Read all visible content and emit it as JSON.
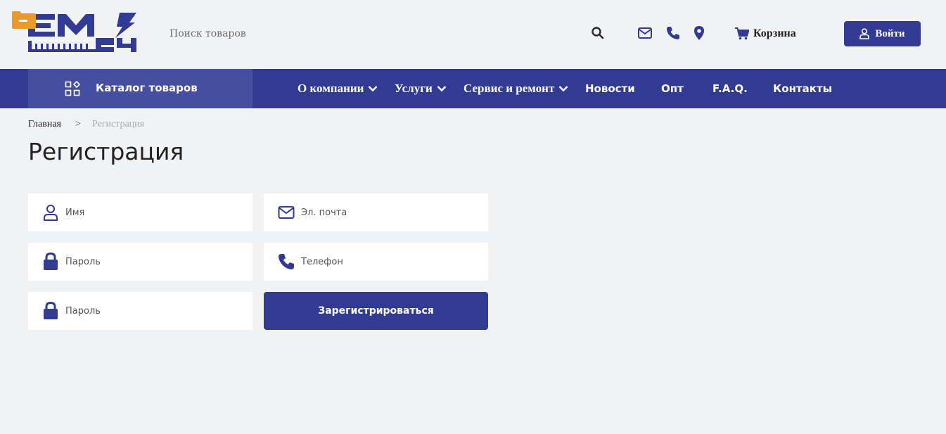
{
  "header": {
    "search_placeholder": "Поиск товаров",
    "cart_label": "Корзина",
    "login_label": "Войти",
    "brand_color": "#323b93",
    "icons": [
      "logo-em24",
      "folder-icon",
      "search-icon",
      "envelope-icon",
      "phone-icon",
      "map-pin-icon",
      "cart-icon",
      "user-icon"
    ]
  },
  "nav": {
    "catalog_label": "Каталог товаров",
    "items": [
      {
        "label": "О компании",
        "has_dropdown": true
      },
      {
        "label": "Услуги",
        "has_dropdown": true
      },
      {
        "label": "Сервис и ремонт",
        "has_dropdown": true
      },
      {
        "label": "Новости",
        "has_dropdown": false
      },
      {
        "label": "Опт",
        "has_dropdown": false
      },
      {
        "label": "F.A.Q.",
        "has_dropdown": false
      },
      {
        "label": "Контакты",
        "has_dropdown": false
      }
    ]
  },
  "breadcrumb": {
    "home": "Главная",
    "separator": ">",
    "current": "Регистрация"
  },
  "page": {
    "title": "Регистрация"
  },
  "form": {
    "name_placeholder": "Имя",
    "email_placeholder": "Эл. почта",
    "password_placeholder": "Пароль",
    "phone_placeholder": "Телефон",
    "password_confirm_placeholder": "Пароль",
    "submit_label": "Зарегистрироваться"
  }
}
